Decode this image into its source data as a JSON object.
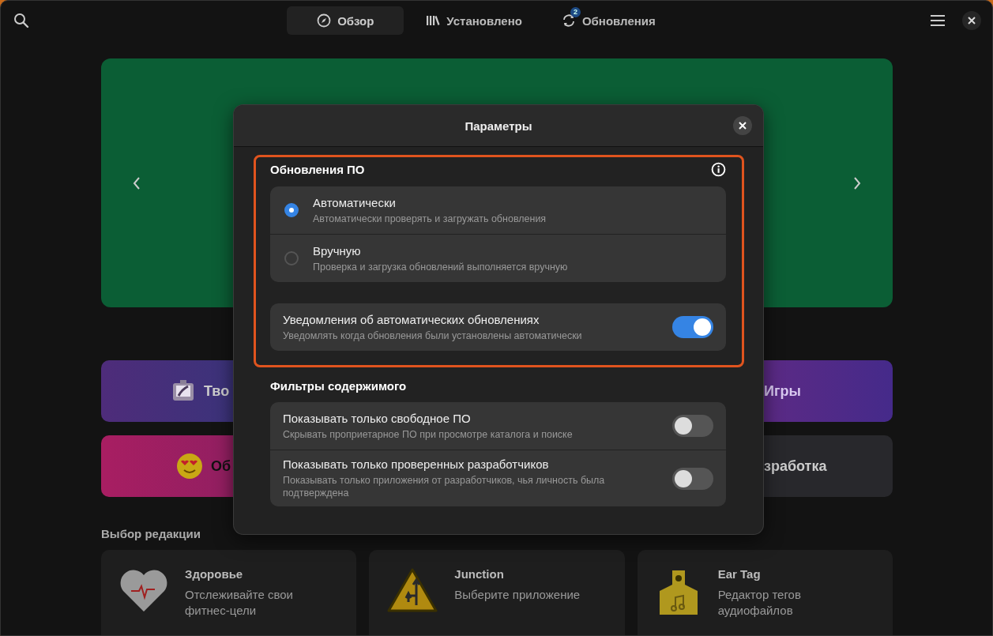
{
  "header": {
    "tabs": [
      {
        "label": "Обзор",
        "selected": true
      },
      {
        "label": "Установлено",
        "selected": false
      },
      {
        "label": "Обновления",
        "selected": false,
        "badge": "2"
      }
    ]
  },
  "categories": [
    {
      "label": "Тво"
    },
    {
      "label": "Игры"
    },
    {
      "label": "Об"
    },
    {
      "label": "зработка"
    }
  ],
  "editors_choice": {
    "title": "Выбор редакции",
    "cards": [
      {
        "title": "Здоровье",
        "description": "Отслеживайте свои фитнес-цели"
      },
      {
        "title": "Junction",
        "description": "Выберите приложение"
      },
      {
        "title": "Ear Tag",
        "description": "Редактор тегов аудиофайлов"
      }
    ]
  },
  "dialog": {
    "title": "Параметры",
    "sections": [
      {
        "title": "Обновления ПО",
        "highlighted": true,
        "info": true,
        "groups": [
          [
            {
              "kind": "radio",
              "title": "Автоматически",
              "subtitle": "Автоматически проверять и загружать обновления",
              "selected": true
            },
            {
              "kind": "radio",
              "title": "Вручную",
              "subtitle": "Проверка и загрузка обновлений выполняется вручную",
              "selected": false
            }
          ],
          [
            {
              "kind": "switch",
              "title": "Уведомления об автоматических обновлениях",
              "subtitle": "Уведомлять когда обновления были установлены автоматически",
              "on": true
            }
          ]
        ]
      },
      {
        "title": "Фильтры содержимого",
        "highlighted": false,
        "info": false,
        "groups": [
          [
            {
              "kind": "switch",
              "title": "Показывать только свободное ПО",
              "subtitle": "Скрывать проприетарное ПО при просмотре каталога и поиске",
              "on": false
            },
            {
              "kind": "switch",
              "title": "Показывать только проверенных разработчиков",
              "subtitle": "Показывать только приложения от разработчиков, чья личность была подтверждена",
              "on": false
            }
          ]
        ]
      }
    ]
  }
}
